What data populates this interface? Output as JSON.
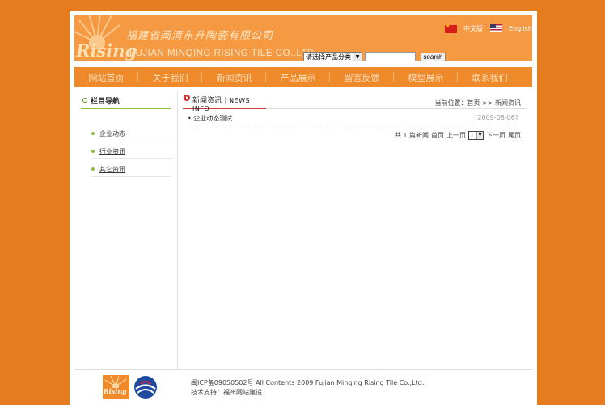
{
  "header": {
    "company_cn": "福建省闽清东升陶瓷有限公司",
    "logo_word": "Rising",
    "company_en": "FUJIAN MINQING RISING TILE CO.,LTD",
    "lang_cn": "中文版",
    "lang_en": "English",
    "category_select": "请选择产品分类",
    "search_button": "search",
    "search_placeholder": ""
  },
  "nav": {
    "items": [
      "网站首页",
      "关于我们",
      "新闻资讯",
      "产品展示",
      "留言反馈",
      "模型展示",
      "联系我们"
    ]
  },
  "sidebar": {
    "title": "栏目导航",
    "items": [
      "企业动态",
      "行业资讯",
      "其它资讯"
    ]
  },
  "main": {
    "tab_cn": "新闻资讯",
    "tab_en": "NEWS INFO",
    "breadcrumb": "当前位置：首页 >> 新闻资讯",
    "news": [
      {
        "title": "企业动态测试",
        "date": "[2009-08-06]"
      }
    ],
    "pager": {
      "total": "共 1 篇新闻",
      "first": "首页",
      "prev": "上一页",
      "page": "1",
      "next": "下一页",
      "last": "尾页"
    }
  },
  "footer": {
    "logo_word": "Rising",
    "line1": "闽ICP备09050502号 All Contents 2009 Fujian Minqing Rising Tile Co.,Ltd.",
    "line2": "技术支持：福州网站建设"
  },
  "colors": {
    "background": "#e57c20",
    "banner": "#f59a42",
    "nav": "#ef8a2a",
    "sidebar_accent": "#8bbf3a",
    "tab_accent": "#d33b3b"
  }
}
